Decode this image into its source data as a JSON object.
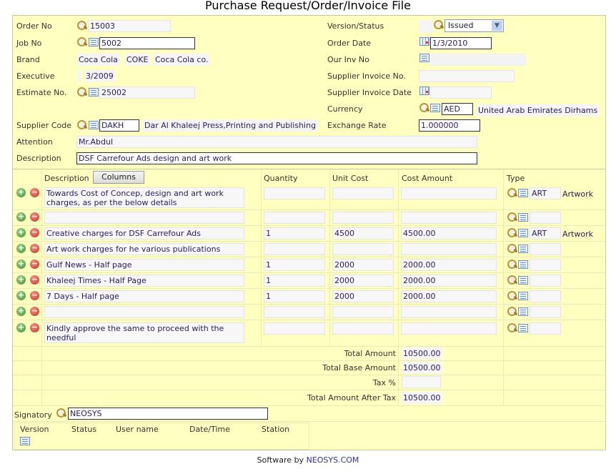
{
  "title": "Purchase Request/Order/Invoice File",
  "header": {
    "order_no": {
      "label": "Order No",
      "value": "15003"
    },
    "job_no": {
      "label": "Job No",
      "value": "5002"
    },
    "brand": {
      "label": "Brand",
      "values": [
        "Coca Cola",
        "COKE",
        "Coca Cola co."
      ]
    },
    "executive": {
      "label": "Executive",
      "value": "3/2009"
    },
    "estimate_no": {
      "label": "Estimate No.",
      "value": "25002"
    },
    "supplier_code": {
      "label": "Supplier Code",
      "value": "DAKH",
      "name": "Dar Al Khaleej Press,Printing and Publishing"
    },
    "attention": {
      "label": "Attention",
      "value": "Mr.Abdul"
    },
    "description": {
      "label": "Description",
      "value": "DSF Carrefour Ads design and art work"
    },
    "version_status": {
      "label": "Version/Status",
      "value": "Issued"
    },
    "order_date": {
      "label": "Order Date",
      "value": "1/3/2010"
    },
    "our_inv_no": {
      "label": "Our Inv No",
      "value": ""
    },
    "supplier_invoice_no": {
      "label": "Supplier Invoice No.",
      "value": ""
    },
    "supplier_invoice_date": {
      "label": "Supplier Invoice Date",
      "value": ""
    },
    "currency": {
      "label": "Currency",
      "value": "AED",
      "name": "United Arab Emirates Dirhams"
    },
    "exchange_rate": {
      "label": "Exchange Rate",
      "value": "1.000000"
    }
  },
  "lines": {
    "columns": {
      "description": "Description",
      "columns_button": "Columns",
      "quantity": "Quantity",
      "unit_cost": "Unit Cost",
      "cost_amount": "Cost Amount",
      "type": "Type"
    },
    "rows": [
      {
        "description": "Towards Cost of Concep, design and art work charges, as per the below details",
        "quantity": "",
        "unit_cost": "",
        "cost_amount": "",
        "type": "ART",
        "type_name": "Artwork"
      },
      {
        "description": "",
        "quantity": "",
        "unit_cost": "",
        "cost_amount": "",
        "type": "",
        "type_name": ""
      },
      {
        "description": "Creative charges for DSF Carrefour Ads",
        "quantity": "1",
        "unit_cost": "4500",
        "cost_amount": "4500.00",
        "type": "ART",
        "type_name": "Artwork"
      },
      {
        "description": "Art work charges for he various publications",
        "quantity": "",
        "unit_cost": "",
        "cost_amount": "",
        "type": "",
        "type_name": ""
      },
      {
        "description": "Gulf News - Half page",
        "quantity": "1",
        "unit_cost": "2000",
        "cost_amount": "2000.00",
        "type": "",
        "type_name": ""
      },
      {
        "description": "Khaleej Times - Half Page",
        "quantity": "1",
        "unit_cost": "2000",
        "cost_amount": "2000.00",
        "type": "",
        "type_name": ""
      },
      {
        "description": "7 Days - Half page",
        "quantity": "1",
        "unit_cost": "2000",
        "cost_amount": "2000.00",
        "type": "",
        "type_name": ""
      },
      {
        "description": "",
        "quantity": "",
        "unit_cost": "",
        "cost_amount": "",
        "type": "",
        "type_name": ""
      },
      {
        "description": "Kindly approve the same to proceed with the needful",
        "quantity": "",
        "unit_cost": "",
        "cost_amount": "",
        "type": "",
        "type_name": ""
      }
    ]
  },
  "totals": {
    "total_amount": {
      "label": "Total Amount",
      "value": "10500.00"
    },
    "total_base_amount": {
      "label": "Total Base Amount",
      "value": "10500.00"
    },
    "tax": {
      "label": "Tax %",
      "value": ""
    },
    "total_after_tax": {
      "label": "Total Amount After Tax",
      "value": "10500.00"
    }
  },
  "signatory": {
    "label": "Signatory",
    "value": "NEOSYS"
  },
  "versions": {
    "columns": [
      "Version",
      "Status",
      "User name",
      "Date/Time",
      "Station"
    ]
  },
  "footer": {
    "prefix": "Software by ",
    "link": "NEOSYS.COM"
  }
}
